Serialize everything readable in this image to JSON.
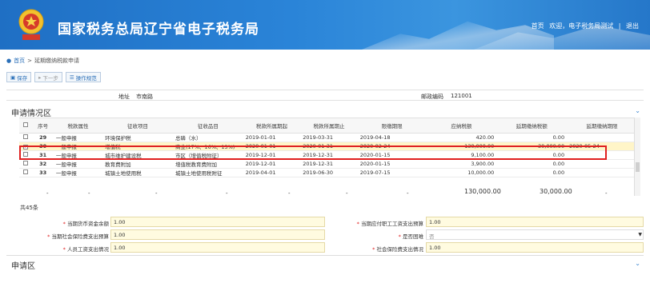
{
  "header": {
    "title": "国家税务总局辽宁省电子税务局",
    "links": [
      "首页",
      "欢迎，电子税务局测试",
      "|",
      "退出"
    ]
  },
  "breadcrumb": {
    "home": "首页",
    "sep": ">",
    "current": "延期缴纳税款申请"
  },
  "toolbar": {
    "save": "保存",
    "next": "下一步",
    "guide": "操作规范"
  },
  "address": {
    "label": "地址",
    "value": "市南路",
    "postcode_label": "邮政编码",
    "postcode_value": "121001"
  },
  "section1": {
    "title": "申请情况区"
  },
  "columns": [
    "",
    "序号",
    "税款属性",
    "征收项目",
    "征收品目",
    "税款所属期起",
    "税款所属期止",
    "限缴期限",
    "应纳税额",
    "延期缴纳税额",
    "延期缴纳期限"
  ],
  "rows": [
    {
      "no": "29",
      "attr": "一般申报",
      "item": "环境保护税",
      "sub": "总磷（水）",
      "start": "2019-01-01",
      "end": "2019-03-31",
      "deadline": "2019-04-18",
      "due": "420.00",
      "delay": "0.00",
      "delay_date": "",
      "selected": false
    },
    {
      "no": "30",
      "attr": "一般申报",
      "item": "增值税",
      "sub": "商业(17%、16%、13%)",
      "start": "2020-01-01",
      "end": "2020-01-31",
      "deadline": "2020-02-24",
      "due": "130,000.00",
      "delay": "30,000.00",
      "delay_date": "2020-05-24",
      "selected": true
    },
    {
      "no": "31",
      "attr": "一般申报",
      "item": "城市维护建设税",
      "sub": "市区（增值税附征）",
      "start": "2019-12-01",
      "end": "2019-12-31",
      "deadline": "2020-01-15",
      "due": "9,100.00",
      "delay": "0.00",
      "delay_date": "",
      "selected": false
    },
    {
      "no": "32",
      "attr": "一般申报",
      "item": "教育费附加",
      "sub": "增值税教育费附加",
      "start": "2019-12-01",
      "end": "2019-12-31",
      "deadline": "2020-01-15",
      "due": "3,900.00",
      "delay": "0.00",
      "delay_date": "",
      "selected": false
    },
    {
      "no": "33",
      "attr": "一般申报",
      "item": "城镇土地使用税",
      "sub": "城镇土地使用税附征",
      "start": "2019-04-01",
      "end": "2019-06-30",
      "deadline": "2019-07-15",
      "due": "10,000.00",
      "delay": "0.00",
      "delay_date": "",
      "selected": false
    }
  ],
  "totals": {
    "dash": "-",
    "due": "130,000.00",
    "delay": "30,000.00"
  },
  "count": "共45条",
  "form": {
    "f1_label": "当期货币资金余额",
    "f1_value": "1.00",
    "f2_label": "当期应付职工工资支出预算",
    "f2_value": "1.00",
    "f3_label": "当期社会保险费支出预算",
    "f3_value": "1.00",
    "f4_label": "是否困难",
    "f4_value": "否",
    "f5_label": "人员工资支出情况",
    "f5_value": "1.00",
    "f6_label": "社会保险费支出情况",
    "f6_value": "1.00",
    "required_mark": "*"
  },
  "section2": {
    "title": "申请区"
  }
}
